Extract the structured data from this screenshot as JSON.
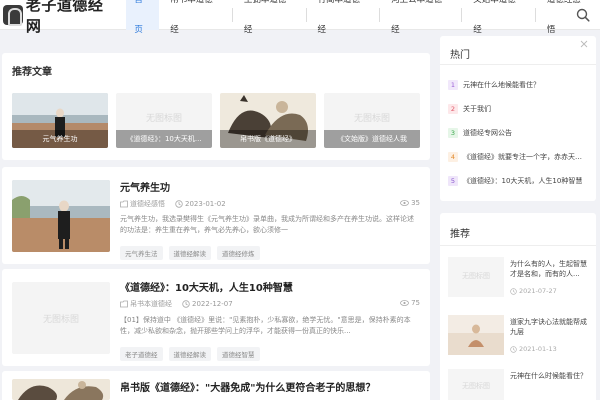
{
  "site": {
    "logo_text": "老子道德经网"
  },
  "nav": {
    "items": [
      {
        "label": "首页",
        "active": true
      },
      {
        "label": "帛书本道德经"
      },
      {
        "label": "王弼本道德经"
      },
      {
        "label": "竹简本道德经"
      },
      {
        "label": "河上公本道德经"
      },
      {
        "label": "文始本道德经"
      },
      {
        "label": "道德经感悟"
      }
    ]
  },
  "recommend": {
    "title": "推荐文章",
    "items": [
      {
        "caption": "元气养生功"
      },
      {
        "caption": "《道德经》：10大天机...",
        "placeholder": "无图标图"
      },
      {
        "caption": "帛书版《道德经》"
      },
      {
        "caption": "《文始版》道德经人我",
        "placeholder": "无图标图"
      }
    ]
  },
  "articles": [
    {
      "title": "元气养生功",
      "category": "道德经感悟",
      "date": "2023-01-02",
      "views": "35",
      "excerpt": "元气养生功，我选录樊得生《元气养生功》录单曲，我成为所谓经和多产在养生功说。这样论述的功法是：养生重在养气，养气必先养心，欲心须修一",
      "tags": [
        "元气养生法",
        "道德经解读",
        "道德经修炼"
      ]
    },
    {
      "title": "《道德经》：10大天机，人生10种智慧",
      "category": "帛书本道德经",
      "date": "2022-12-07",
      "views": "75",
      "placeholder": "无图标图",
      "excerpt": "【01】保持道中 《道德经》里说：\"见素抱朴，少私寡欲，绝学无忧。\"意思是，保持朴素的本性，减少私欲和杂念，抛开那些学问上的浮华，才能获得一份真正的快乐...",
      "tags": [
        "老子道德经",
        "道德经解读",
        "道德经智慧"
      ]
    },
    {
      "title": "帛书版《道德经》：\"大器免成\"为什么更符合老子的思想？"
    }
  ],
  "sidebar": {
    "hot": {
      "title": "热门",
      "items": [
        {
          "rank": "1",
          "text": "元神在什么地候能看住？"
        },
        {
          "rank": "2",
          "text": "关于我们"
        },
        {
          "rank": "3",
          "text": "道德经专网公告"
        },
        {
          "rank": "4",
          "text": "《道德经》就要专注一个字，赤赤天不..."
        },
        {
          "rank": "5",
          "text": "《道德经》：10大天机，人生10种智慧"
        }
      ]
    },
    "recommend": {
      "title": "推荐",
      "items": [
        {
          "title": "为什么有的人，生起智慧才是名和，而有的人...",
          "date": "2021-07-27",
          "placeholder": "无图标图"
        },
        {
          "title": "道家九字诀心法就能帮成九层",
          "date": "2021-01-13"
        },
        {
          "title": "元神在什么时候能看住？",
          "date": "",
          "placeholder": "无图标图"
        }
      ]
    }
  },
  "colors": {
    "accent": "#2f7bdc",
    "background": "#f1f2f6"
  },
  "icons": {
    "search": "search-icon",
    "category": "folder-icon",
    "date": "clock-icon",
    "views": "eye-icon"
  }
}
